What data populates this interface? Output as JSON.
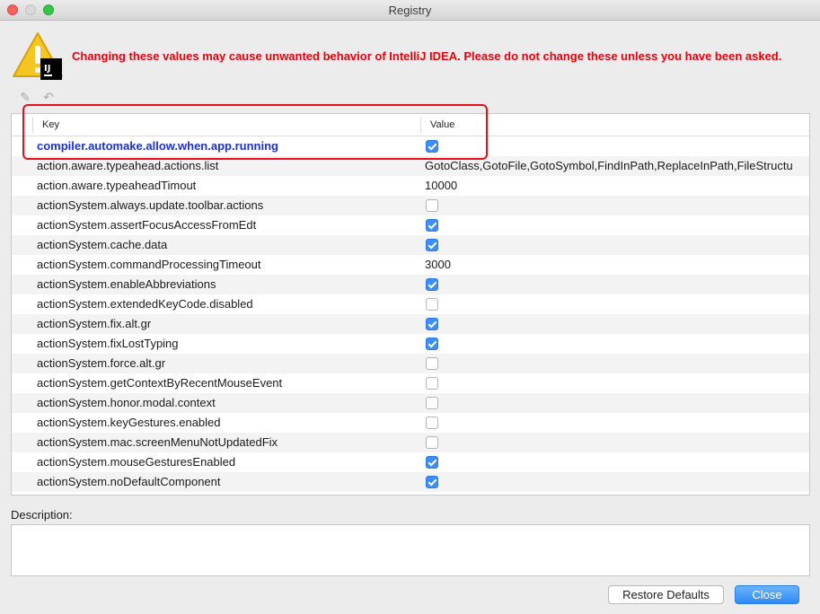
{
  "window": {
    "title": "Registry"
  },
  "warning": {
    "text": "Changing these values may cause unwanted behavior of IntelliJ IDEA. Please do not change these unless you have been asked.",
    "badge": "IJ"
  },
  "toolbar": {
    "edit_icon": "pencil-icon",
    "revert_icon": "undo-icon"
  },
  "table": {
    "headers": {
      "key": "Key",
      "value": "Value"
    },
    "rows": [
      {
        "key": "compiler.automake.allow.when.app.running",
        "type": "bool",
        "checked": true
      },
      {
        "key": "action.aware.typeahead.actions.list",
        "type": "text",
        "value": "GotoClass,GotoFile,GotoSymbol,FindInPath,ReplaceInPath,FileStructu"
      },
      {
        "key": "action.aware.typeaheadTimout",
        "type": "text",
        "value": "10000"
      },
      {
        "key": "actionSystem.always.update.toolbar.actions",
        "type": "bool",
        "checked": false
      },
      {
        "key": "actionSystem.assertFocusAccessFromEdt",
        "type": "bool",
        "checked": true
      },
      {
        "key": "actionSystem.cache.data",
        "type": "bool",
        "checked": true
      },
      {
        "key": "actionSystem.commandProcessingTimeout",
        "type": "text",
        "value": "3000"
      },
      {
        "key": "actionSystem.enableAbbreviations",
        "type": "bool",
        "checked": true
      },
      {
        "key": "actionSystem.extendedKeyCode.disabled",
        "type": "bool",
        "checked": false
      },
      {
        "key": "actionSystem.fix.alt.gr",
        "type": "bool",
        "checked": true
      },
      {
        "key": "actionSystem.fixLostTyping",
        "type": "bool",
        "checked": true
      },
      {
        "key": "actionSystem.force.alt.gr",
        "type": "bool",
        "checked": false
      },
      {
        "key": "actionSystem.getContextByRecentMouseEvent",
        "type": "bool",
        "checked": false
      },
      {
        "key": "actionSystem.honor.modal.context",
        "type": "bool",
        "checked": false
      },
      {
        "key": "actionSystem.keyGestures.enabled",
        "type": "bool",
        "checked": false
      },
      {
        "key": "actionSystem.mac.screenMenuNotUpdatedFix",
        "type": "bool",
        "checked": false
      },
      {
        "key": "actionSystem.mouseGesturesEnabled",
        "type": "bool",
        "checked": true
      },
      {
        "key": "actionSystem.noDefaultComponent",
        "type": "bool",
        "checked": true
      }
    ]
  },
  "description": {
    "label": "Description:",
    "value": ""
  },
  "buttons": {
    "restore": "Restore Defaults",
    "close": "Close"
  },
  "colors": {
    "warning": "#e8000b",
    "accent": "#3d8ef7",
    "highlight_key": "#1b2fd8",
    "annotation_box": "#e8101a"
  }
}
